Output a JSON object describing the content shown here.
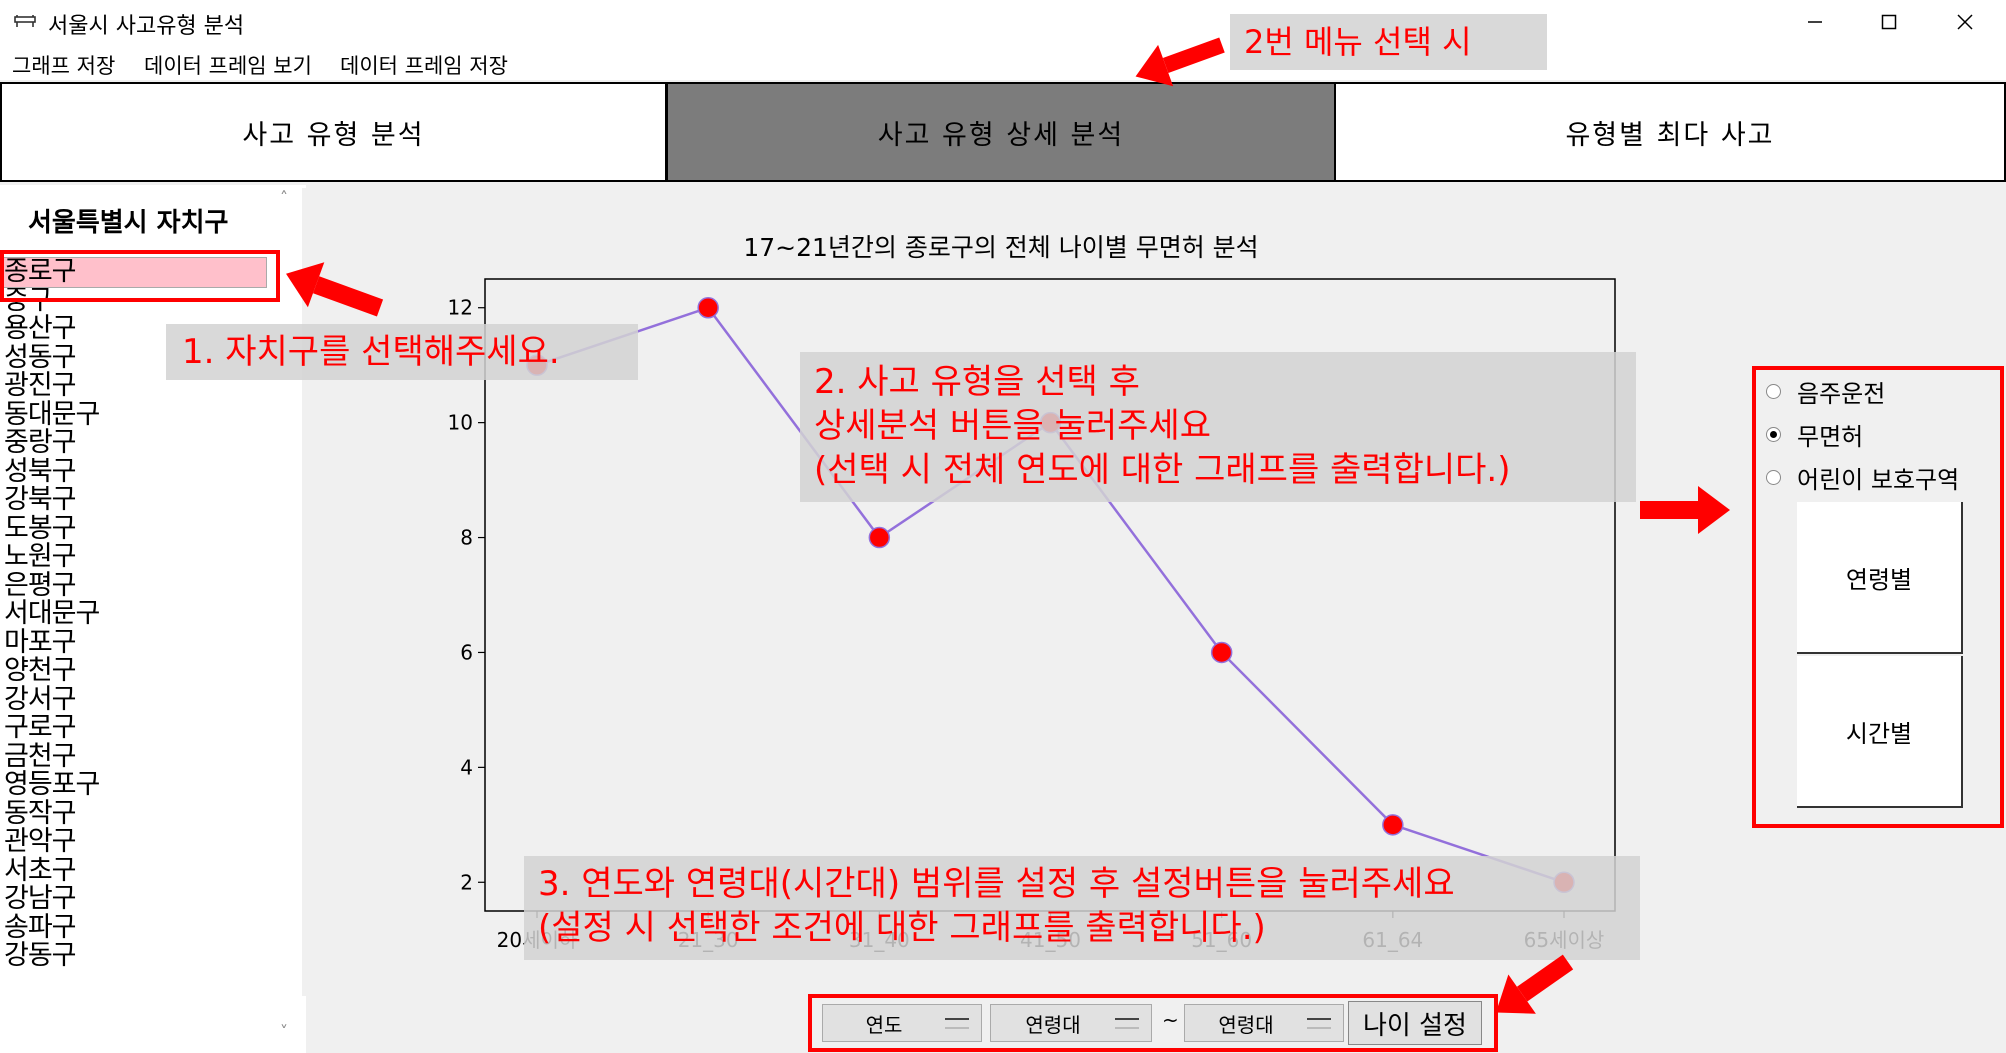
{
  "window": {
    "title": "서울시 사고유형 분석"
  },
  "menu": [
    "그래프 저장",
    "데이터 프레임 보기",
    "데이터 프레임 저장"
  ],
  "tabs": [
    {
      "label": "사고 유형 분석",
      "active": false
    },
    {
      "label": "사고 유형 상세 분석",
      "active": true
    },
    {
      "label": "유형별 최다 사고",
      "active": false
    }
  ],
  "sidebar": {
    "heading": "서울특별시 자치구",
    "selected_index": 0,
    "districts": [
      "종로구",
      "중구",
      "용산구",
      "성동구",
      "광진구",
      "동대문구",
      "중랑구",
      "성북구",
      "강북구",
      "도봉구",
      "노원구",
      "은평구",
      "서대문구",
      "마포구",
      "양천구",
      "강서구",
      "구로구",
      "금천구",
      "영등포구",
      "동작구",
      "관악구",
      "서초구",
      "강남구",
      "송파구",
      "강동구"
    ]
  },
  "chart_data": {
    "type": "line",
    "title": "17~21년간의 종로구의 전체 나이별 무면허 분석",
    "categories": [
      "20세이하",
      "21_30",
      "31_40",
      "41_50",
      "51_60",
      "61_64",
      "65세이상"
    ],
    "series": [
      {
        "values": [
          11,
          12,
          8,
          10,
          6,
          3,
          2
        ]
      }
    ],
    "yticks": [
      2,
      4,
      6,
      8,
      10,
      12
    ],
    "ylim": [
      1.5,
      12.5
    ],
    "line_color": "#9370db",
    "marker_color": "#ff0000",
    "grid": false
  },
  "right_panel": {
    "radios": [
      {
        "label": "음주운전",
        "checked": false
      },
      {
        "label": "무면허",
        "checked": true
      },
      {
        "label": "어린이 보호구역",
        "checked": false
      }
    ],
    "buttons": [
      "연령별",
      "시간별"
    ]
  },
  "bottom_controls": {
    "year_combo": "연도",
    "age_from_combo": "연령대",
    "tilde": "~",
    "age_to_combo": "연령대",
    "set_button": "나이 설정"
  },
  "annotations": {
    "top_callout": "2번 메뉴 선택 시",
    "step1": "1. 자치구를 선택해주세요.",
    "step2": [
      "2. 사고 유형을 선택 후",
      "상세분석 버튼을 눌러주세요",
      "(선택 시 전체 연도에 대한 그래프를 출력합니다.)"
    ],
    "step3": [
      "3. 연도와 연령대(시간대) 범위를 설정 후 설정버튼을 눌러주세요",
      "(설정 시 선택한 조건에 대한 그래프를 출력합니다.)"
    ],
    "color": "#ff0000"
  }
}
